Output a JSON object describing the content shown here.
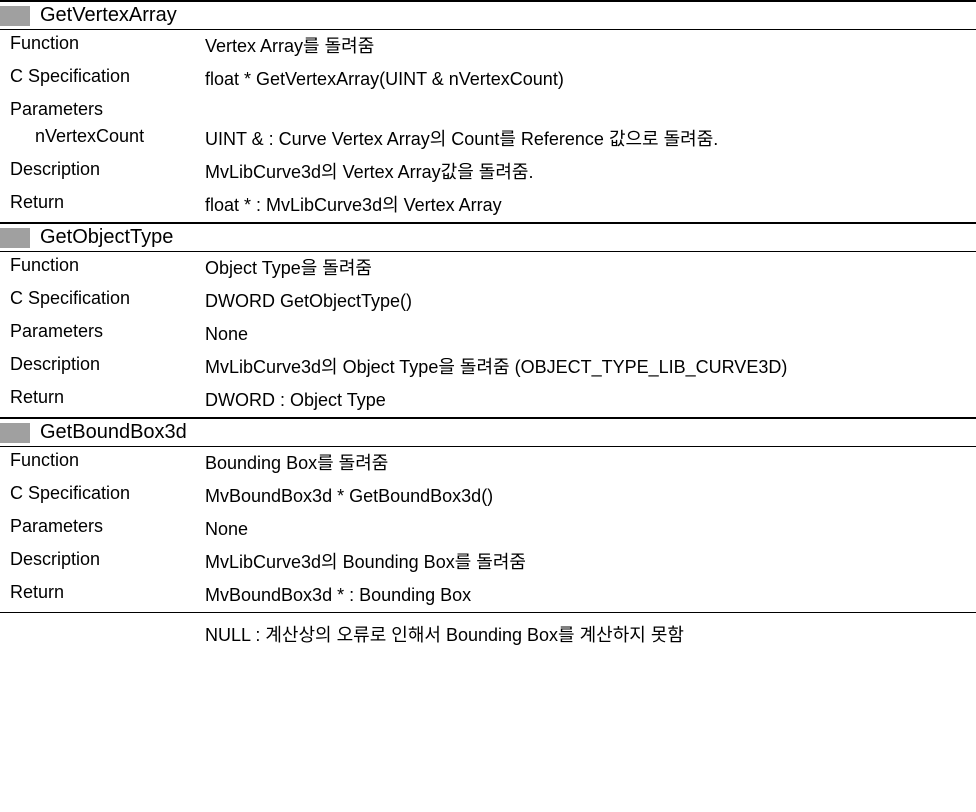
{
  "sections": [
    {
      "title": "GetVertexArray",
      "rows": [
        {
          "label": "Function",
          "value": "Vertex Array를 돌려줌"
        },
        {
          "label": "C Specification",
          "value": "float * GetVertexArray(UINT    & nVertexCount)"
        },
        {
          "label": "Parameters",
          "value": ""
        },
        {
          "label": "nVertexCount",
          "indent": true,
          "value": "UINT &   : Curve Vertex Array의 Count를 Reference 값으로    돌려줌."
        },
        {
          "label": "Description",
          "value": "MvLibCurve3d의 Vertex Array값을 돌려줌."
        },
        {
          "label": "Return",
          "value": "float * : MvLibCurve3d의 Vertex Array"
        }
      ]
    },
    {
      "title": "GetObjectType",
      "rows": [
        {
          "label": "Function",
          "value": "Object Type을 돌려줌"
        },
        {
          "label": "C Specification",
          "value": "DWORD GetObjectType()"
        },
        {
          "label": "Parameters",
          "value": "None"
        },
        {
          "label": "Description",
          "value": "MvLibCurve3d의 Object Type을 돌려줌 (OBJECT_TYPE_LIB_CURVE3D)"
        },
        {
          "label": "Return",
          "value": "DWORD : Object Type"
        }
      ]
    },
    {
      "title": "GetBoundBox3d",
      "rows": [
        {
          "label": "Function",
          "value": "Bounding Box를 돌려줌"
        },
        {
          "label": "C Specification",
          "value": "MvBoundBox3d * GetBoundBox3d()"
        },
        {
          "label": "Parameters",
          "value": "None"
        },
        {
          "label": "Description",
          "value": "MvLibCurve3d의 Bounding Box를 돌려줌"
        },
        {
          "label": "Return",
          "value": "MvBoundBox3d * : Bounding Box"
        },
        {
          "label": "",
          "value": ""
        },
        {
          "label": "",
          "value": "NULL : 계산상의 오류로 인해서 Bounding Box를 계산하지    못함"
        }
      ]
    }
  ]
}
